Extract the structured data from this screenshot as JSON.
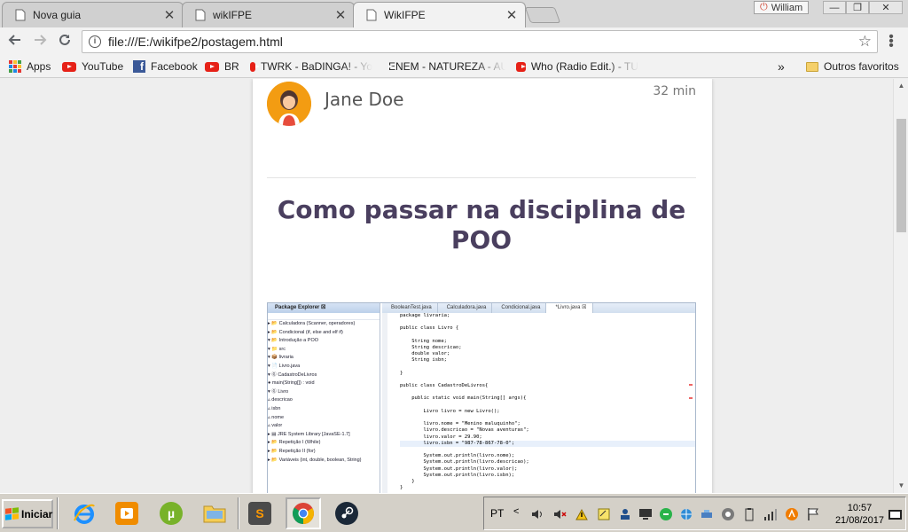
{
  "browser": {
    "tabs": [
      {
        "title": "Nova guia",
        "active": false
      },
      {
        "title": "wikIFPE",
        "active": false
      },
      {
        "title": "WikIFPE",
        "active": true
      }
    ],
    "user_badge": "William",
    "window_buttons": {
      "minimize": "—",
      "restore": "❐",
      "close": "✕"
    },
    "url": "file:///E:/wikifpe2/postagem.html",
    "bookmarks": [
      {
        "label": "Apps",
        "icon": "apps-grid-icon"
      },
      {
        "label": "YouTube",
        "icon": "youtube-icon"
      },
      {
        "label": "Facebook",
        "icon": "facebook-icon"
      },
      {
        "label": "BR",
        "icon": "youtube-icon"
      },
      {
        "label": "TWRK - BaDINGA! - Yo",
        "icon": "youtube-icon"
      },
      {
        "label": "ENEM - NATUREZA - AU",
        "icon": "youtube-icon"
      },
      {
        "label": "Who (Radio Edit.) - TU",
        "icon": "youtube-icon"
      }
    ],
    "bookmarks_overflow": "»",
    "other_bookmarks": "Outros favoritos"
  },
  "post": {
    "author": "Jane Doe",
    "time": "32 min",
    "title": "Como passar na disciplina de POO"
  },
  "embedded_ide": {
    "panel_title": "Package Explorer ☒",
    "tree": [
      "▸ 📂 Calculadora (Scanner, operadores)",
      "▸ 📂 Condicional (if, else and elf if)",
      "▾ 📂 Introdução a POO",
      "   ▾ 📁 src",
      "      ▾ 📦 livraria",
      "         ▾ 📄 Livro.java",
      "            ▾ Ⓖ CadastroDeLivros",
      "                  ● main(String[]) : void",
      "            ▾ Ⓖ Livro",
      "                  ▵ descricao",
      "                  ▵ isbn",
      "                  ▵ nome",
      "                  ▵ valor",
      "▸ ▤ JRE System Library [JavaSE-1.7]",
      "▸ 📂 Repetição I (While)",
      "▸ 📂 Repetição II (for)",
      "▸ 📂 Variáveis (int, double, boolean, String)"
    ],
    "editor_tabs": [
      "BooleanTest.java",
      "Calculadora.java",
      "Condicional.java",
      "*Livro.java ☒"
    ],
    "code": [
      "package livraria;",
      "",
      "public class Livro {",
      "",
      "    String nome;",
      "    String descricao;",
      "    double valor;",
      "    String isbn;",
      "",
      "}",
      "",
      "public class CadastroDeLivros{",
      "",
      "    public static void main(String[] args){",
      "",
      "        Livro livro = new Livro();",
      "",
      "        livro.nome = \"Menino maluquinho\";",
      "        livro.descricao = \"Novas aventuras\";",
      "        livro.valor = 29.90;",
      "        livro.isbn = \"987-78-867-78-0\";",
      "",
      "        System.out.println(livro.nome);",
      "        System.out.println(livro.descricao);",
      "        System.out.println(livro.valor);",
      "        System.out.println(livro.isbn);",
      "    }",
      "}"
    ]
  },
  "taskbar": {
    "start_label": "Iniciar",
    "language": "PT",
    "tray_expand": "<",
    "time": "10:57",
    "date": "21/08/2017"
  },
  "colors": {
    "title": "#4a3f5f",
    "avatar": "#f39c12",
    "youtube": "#e62117",
    "facebook": "#3b5998"
  }
}
